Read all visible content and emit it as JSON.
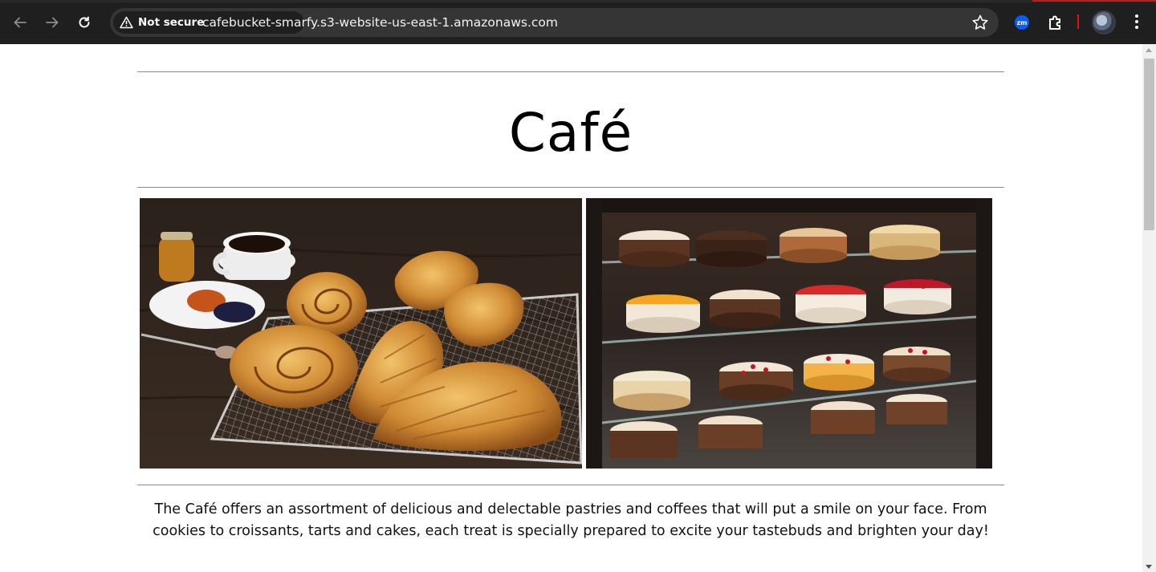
{
  "browser": {
    "security_label": "Not secure",
    "url": "cafebucket-smarfy.s3-website-us-east-1.amazonaws.com",
    "extension_zoom_label": "zm",
    "icons": [
      "back-arrow-icon",
      "forward-arrow-icon",
      "reload-icon",
      "warning-triangle-icon",
      "star-icon",
      "zoom-extension-icon",
      "puzzle-icon",
      "profile-avatar",
      "kebab-menu-icon"
    ]
  },
  "page": {
    "title": "Café",
    "images": [
      {
        "name": "pastries-photo",
        "subject": "croissants, danish pastries and coffee"
      },
      {
        "name": "cakes-display-photo",
        "subject": "cakes in a glass display case"
      }
    ],
    "intro_text": "The Café offers an assortment of delicious and delectable pastries and coffees that will put a smile on your face. From cookies to croissants, tarts and cakes, each treat is specially prepared to excite your tastebuds and brighten your day!"
  },
  "colors": {
    "chrome_bg": "#1f1f1f",
    "omnibox_bg": "#353535",
    "accent_red": "#c21b1b",
    "page_bg": "#ffffff",
    "rule": "#8a8a8a"
  }
}
